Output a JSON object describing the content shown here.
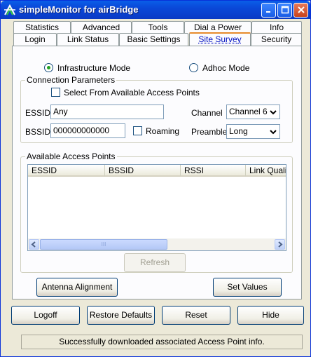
{
  "window": {
    "title": "simpleMonitor for airBridge"
  },
  "tabs_top": [
    "Statistics",
    "Advanced",
    "Tools",
    "Dial a Power",
    "Info"
  ],
  "tabs_bottom": [
    "Login",
    "Link Status",
    "Basic Settings",
    "Site Survey",
    "Security"
  ],
  "active_tab": "Site Survey",
  "mode": {
    "infrastructure_label": "Infrastructure Mode",
    "adhoc_label": "Adhoc Mode",
    "selected": "Infrastructure Mode"
  },
  "connection": {
    "group_title": "Connection Parameters",
    "select_from_label": "Select From Available Access Points",
    "select_from_checked": false,
    "essid_label": "ESSID",
    "essid_value": "Any",
    "bssid_label": "BSSID",
    "bssid_value": "000000000000",
    "roaming_label": "Roaming",
    "roaming_checked": false,
    "channel_label": "Channel",
    "channel_value": "Channel 6",
    "preamble_label": "Preamble",
    "preamble_value": "Long"
  },
  "access_points": {
    "group_title": "Available Access Points",
    "columns": [
      "ESSID",
      "BSSID",
      "RSSI",
      "Link Quality"
    ],
    "rows": [],
    "scroll_thumb_glyph": "III"
  },
  "buttons": {
    "refresh": "Refresh",
    "antenna_alignment": "Antenna Alignment",
    "set_values": "Set Values",
    "logoff": "Logoff",
    "restore_defaults": "Restore Defaults",
    "reset": "Reset",
    "hide": "Hide"
  },
  "status": "Successfully downloaded associated Access Point info.",
  "icons": {
    "app": "airbridge-logo-icon",
    "minimize": "minimize-icon",
    "maximize": "maximize-icon",
    "close": "close-icon"
  },
  "colors": {
    "titlebar": "#0a48d8",
    "active_tab_accent": "#e68b2c",
    "face": "#ece9d8",
    "page": "#fcfcfe"
  }
}
